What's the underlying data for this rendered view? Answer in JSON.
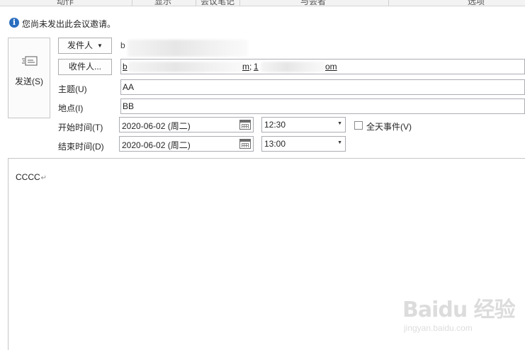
{
  "ribbon": {
    "groups": [
      "动作",
      "显示",
      "会议笔记",
      "与会者",
      "选项"
    ]
  },
  "infobar": {
    "icon": "info-icon",
    "message": "您尚未发出此会议邀请。"
  },
  "send_button": {
    "label": "发送(S)",
    "icon": "envelope-send-icon"
  },
  "from": {
    "button_label": "发件人",
    "value": "b"
  },
  "to": {
    "button_label": "收件人...",
    "recipient1_start": "b",
    "recipient1_end": "m",
    "separator": ";",
    "recipient2_start": "1",
    "recipient2_end": "om"
  },
  "subject": {
    "label": "主题(U)",
    "value": "AA"
  },
  "location": {
    "label": "地点(I)",
    "value": "BB"
  },
  "start": {
    "label": "开始时间(T)",
    "date": "2020-06-02 (周二)",
    "time": "12:30"
  },
  "end": {
    "label": "结束时间(D)",
    "date": "2020-06-02 (周二)",
    "time": "13:00"
  },
  "all_day": {
    "label": "全天事件(V)",
    "checked": false
  },
  "body": {
    "text": "CCCC",
    "para_mark": "↵"
  },
  "watermark": {
    "main": "Baidu 经验",
    "sub": "jingyan.baidu.com"
  }
}
